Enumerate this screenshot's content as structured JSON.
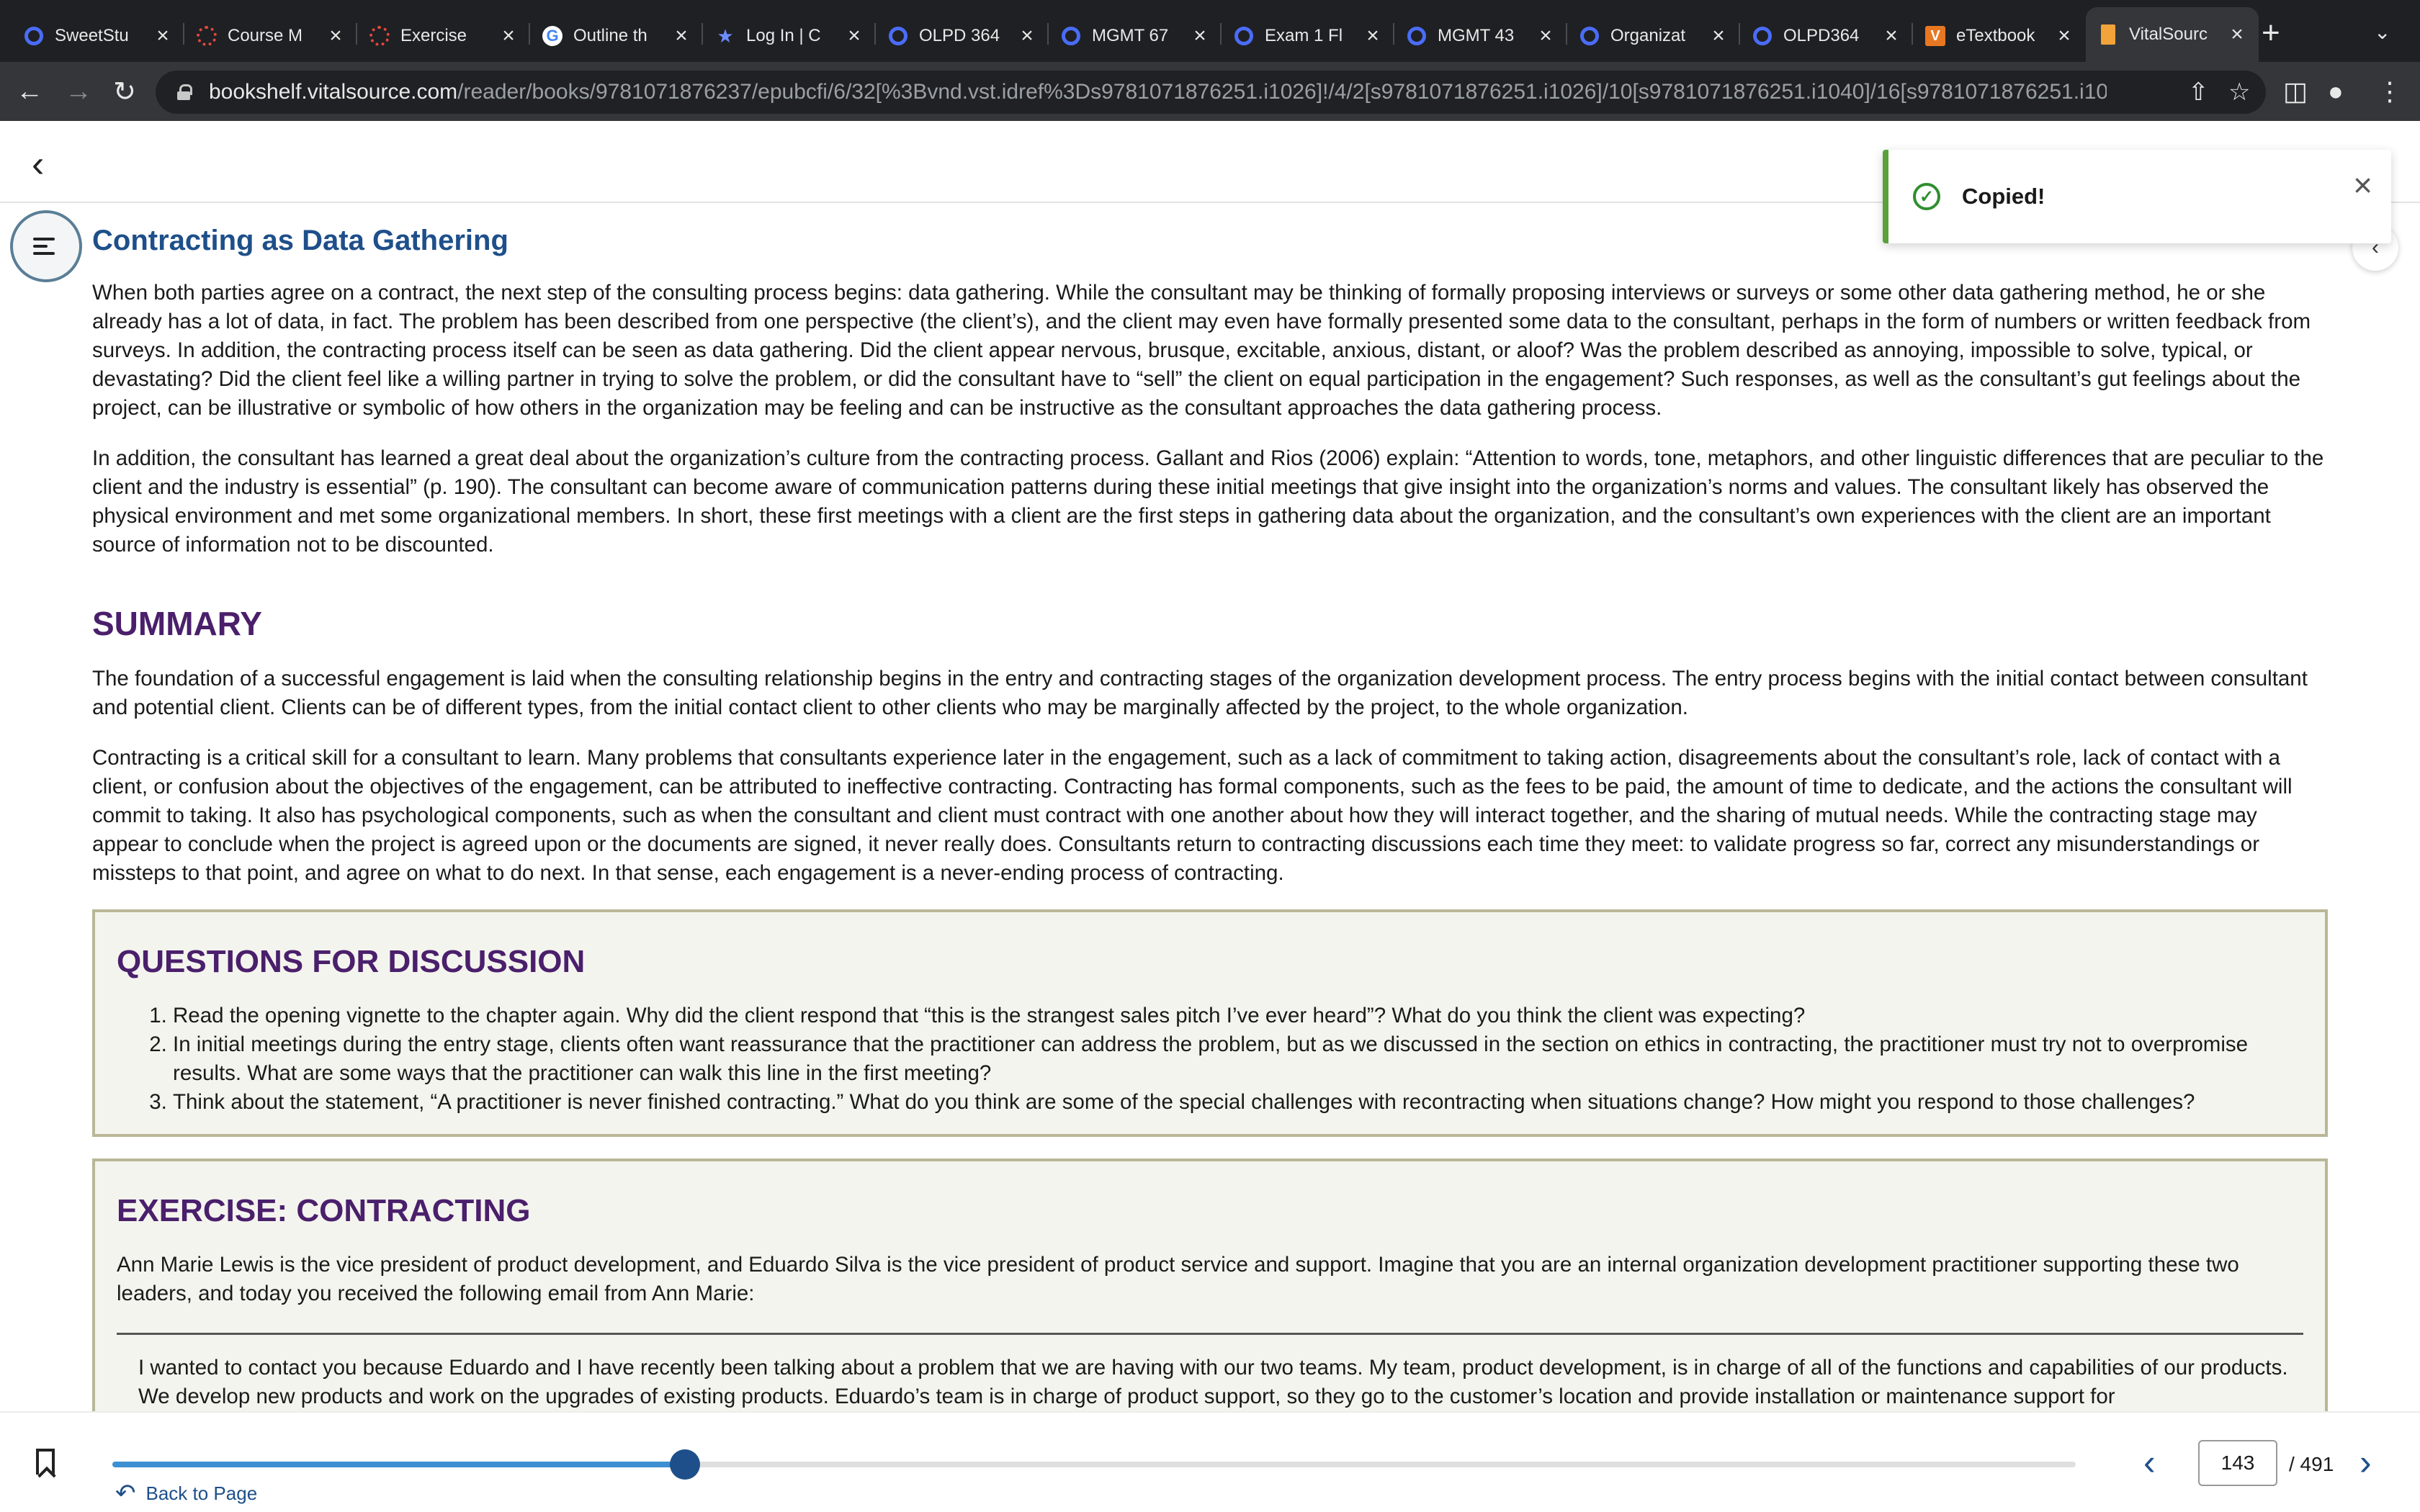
{
  "browser": {
    "tabs": [
      {
        "title": "SweetStu",
        "icon": "ring-icon",
        "color": "#4a6cf7"
      },
      {
        "title": "Course M",
        "icon": "dots-icon",
        "color": "#e4483f"
      },
      {
        "title": "Exercise",
        "icon": "dots-icon",
        "color": "#e4483f"
      },
      {
        "title": "Outline th",
        "icon": "google-icon",
        "color": "#4285f4"
      },
      {
        "title": "Log In | C",
        "icon": "star-icon",
        "color": "#6c8cff"
      },
      {
        "title": "OLPD 364",
        "icon": "ring-icon",
        "color": "#4a6cf7"
      },
      {
        "title": "MGMT 67",
        "icon": "ring-icon",
        "color": "#4a6cf7"
      },
      {
        "title": "Exam 1 Fl",
        "icon": "ring-icon",
        "color": "#4a6cf7"
      },
      {
        "title": "MGMT 43",
        "icon": "ring-icon",
        "color": "#4a6cf7"
      },
      {
        "title": "Organizat",
        "icon": "ring-icon",
        "color": "#4a6cf7"
      },
      {
        "title": "OLPD364",
        "icon": "ring-icon",
        "color": "#4a6cf7"
      },
      {
        "title": "eTextbook",
        "icon": "v-icon",
        "color": "#e87722"
      },
      {
        "title": "VitalSourc",
        "icon": "book-icon",
        "color": "#f2a33a",
        "active": true
      }
    ],
    "url_domain": "bookshelf.vitalsource.com",
    "url_path": "/reader/books/9781071876237/epubcfi/6/32[%3Bvnd.vst.idref%3Ds9781071876251.i1026]!/4/2[s9781071876251.i1026]/10[s9781071876251.i1040]/16[s9781071876251.i1058]/2/..."
  },
  "toast": {
    "message": "Copied!"
  },
  "content": {
    "section_heading": "Contracting as Data Gathering",
    "paragraphs_1": [
      "When both parties agree on a contract, the next step of the consulting process begins: data gathering. While the consultant may be thinking of formally proposing interviews or surveys or some other data gathering method, he or she already has a lot of data, in fact. The problem has been described from one perspective (the client’s), and the client may even have formally presented some data to the consultant, perhaps in the form of numbers or written feedback from surveys. In addition, the contracting process itself can be seen as data gathering. Did the client appear nervous, brusque, excitable, anxious, distant, or aloof? Was the problem described as annoying, impossible to solve, typical, or devastating? Did the client feel like a willing partner in trying to solve the problem, or did the consultant have to “sell” the client on equal participation in the engagement? Such responses, as well as the consultant’s gut feelings about the project, can be illustrative or symbolic of how others in the organization may be feeling and can be instructive as the consultant approaches the data gathering process.",
      "In addition, the consultant has learned a great deal about the organization’s culture from the contracting process. Gallant and Rios (2006) explain: “Attention to words, tone, metaphors, and other linguistic differences that are peculiar to the client and the industry is essential” (p. 190). The consultant can become aware of communication patterns during these initial meetings that give insight into the organization’s norms and values. The consultant likely has observed the physical environment and met some organizational members. In short, these first meetings with a client are the first steps in gathering data about the organization, and the consultant’s own experiences with the client are an important source of information not to be discounted."
    ],
    "summary_heading": "SUMMARY",
    "paragraphs_2": [
      "The foundation of a successful engagement is laid when the consulting relationship begins in the entry and contracting stages of the organization development process. The entry process begins with the initial contact between consultant and potential client. Clients can be of different types, from the initial contact client to other clients who may be marginally affected by the project, to the whole organization.",
      "Contracting is a critical skill for a consultant to learn. Many problems that consultants experience later in the engagement, such as a lack of commitment to taking action, disagreements about the consultant’s role, lack of contact with a client, or confusion about the objectives of the engagement, can be attributed to ineffective contracting. Contracting has formal components, such as the fees to be paid, the amount of time to dedicate, and the actions the consultant will commit to taking. It also has psychological components, such as when the consultant and client must contract with one another about how they will interact together, and the sharing of mutual needs. While the contracting stage may appear to conclude when the project is agreed upon or the documents are signed, it never really does. Consultants return to contracting discussions each time they meet: to validate progress so far, correct any misunderstandings or missteps to that point, and agree on what to do next. In that sense, each engagement is a never-ending process of contracting."
    ],
    "questions_heading": "QUESTIONS FOR DISCUSSION",
    "questions": [
      "Read the opening vignette to the chapter again. Why did the client respond that “this is the strangest sales pitch I’ve ever heard”? What do you think the client was expecting?",
      "In initial meetings during the entry stage, clients often want reassurance that the practitioner can address the problem, but as we discussed in the section on ethics in contracting, the practitioner must try not to overpromise results. What are some ways that the practitioner can walk this line in the first meeting?",
      "Think about the statement, “A practitioner is never finished contracting.” What do you think are some of the special challenges with recontracting when situations change? How might you respond to those challenges?"
    ],
    "exercise_heading": "EXERCISE: CONTRACTING",
    "exercise_intro": "Ann Marie Lewis is the vice president of product development, and Eduardo Silva is the vice president of product service and support. Imagine that you are an internal organization development practitioner supporting these two leaders, and today you received the following email from Ann Marie:",
    "email_text": "I wanted to contact you because Eduardo and I have recently been talking about a problem that we are having with our two teams. My team, product development, is in charge of all of the functions and capabilities of our products. We develop new products and work on the upgrades of existing products. Eduardo’s team is in charge of product support, so they go to the customer’s location and provide installation or maintenance support for"
  },
  "footer": {
    "back_to_page": "Back to Page",
    "current_page": "143",
    "total_pages": "/ 491",
    "progress": 0.2917,
    "accent": "#1e4f8a"
  }
}
